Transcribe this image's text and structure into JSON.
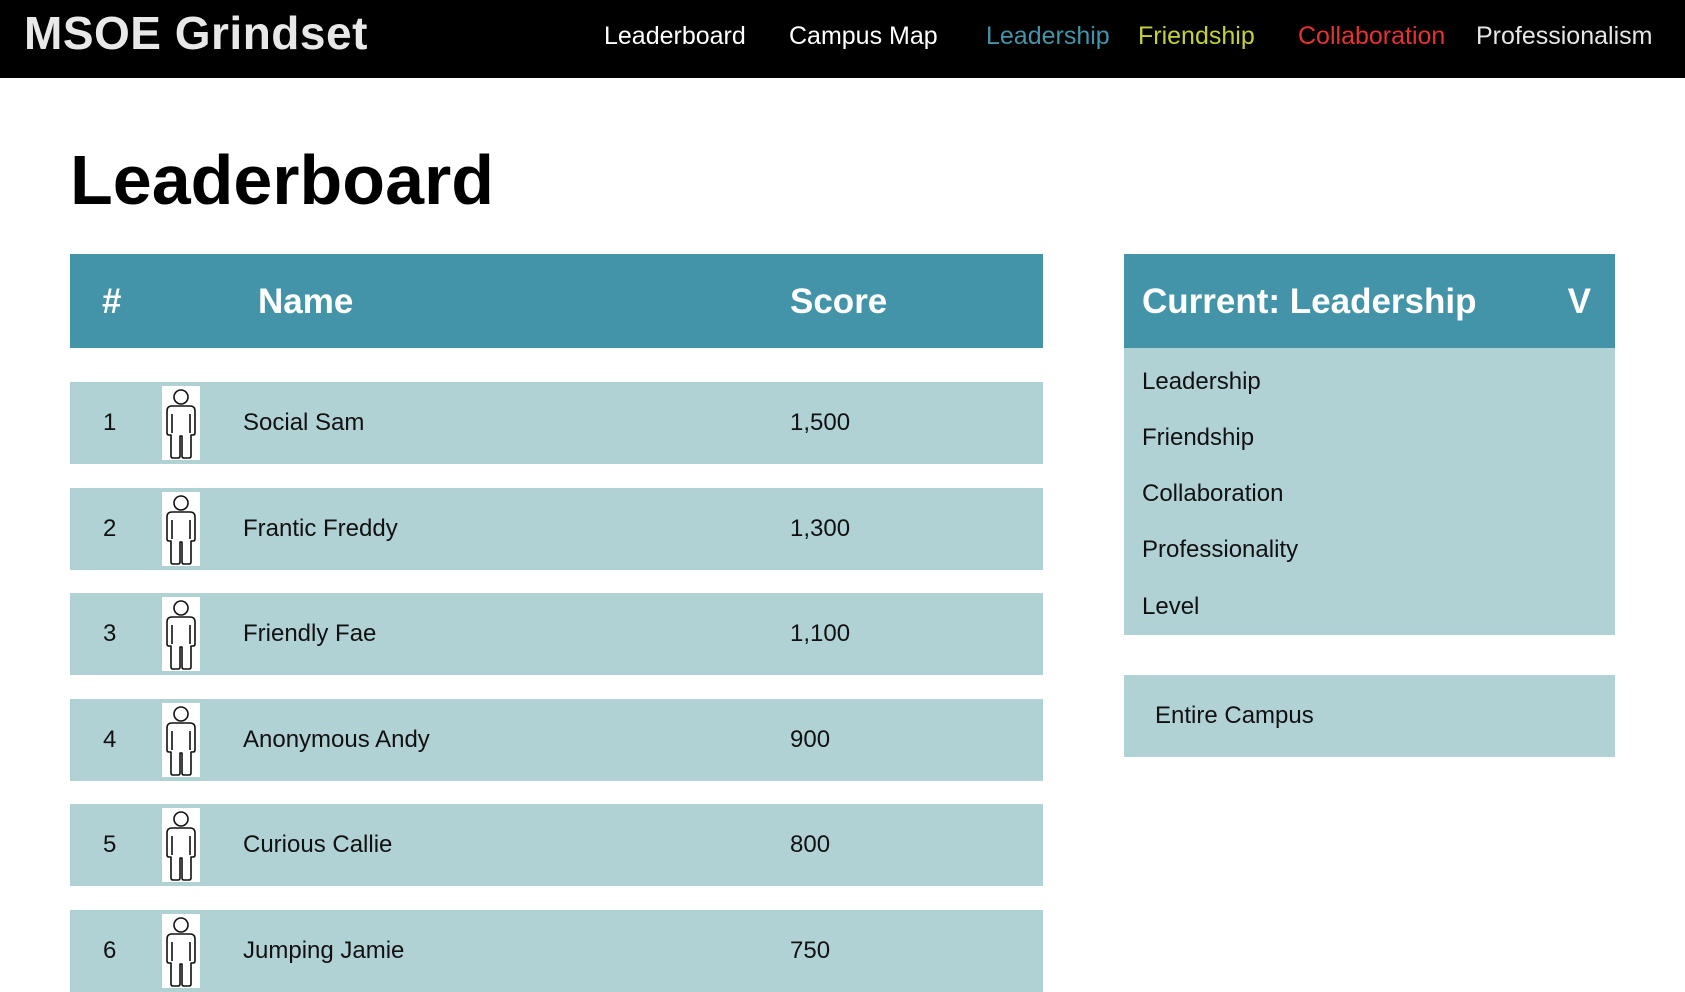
{
  "app": {
    "brand": "MSOE Grindset"
  },
  "nav": {
    "leaderboard": "Leaderboard",
    "campus_map": "Campus Map",
    "leadership": "Leadership",
    "friendship": "Friendship",
    "collaboration": "Collaboration",
    "professionalism": "Professionalism"
  },
  "colors": {
    "leadership": "#4394a8",
    "friendship": "#c6d13a",
    "collaboration": "#e53232",
    "professionalism": "#e6e6e6",
    "header_bg": "#4394a8",
    "row_bg": "#b1d2d5"
  },
  "page": {
    "title": "Leaderboard"
  },
  "table": {
    "headers": {
      "rank": "#",
      "name": "Name",
      "score": "Score"
    },
    "rows": [
      {
        "rank": "1",
        "name": "Social Sam",
        "score": "1,500",
        "avatar_icon": "person-outline-icon"
      },
      {
        "rank": "2",
        "name": "Frantic Freddy",
        "score": "1,300",
        "avatar_icon": "person-outline-icon"
      },
      {
        "rank": "3",
        "name": "Friendly Fae",
        "score": "1,100",
        "avatar_icon": "person-outline-icon"
      },
      {
        "rank": "4",
        "name": "Anonymous Andy",
        "score": "900",
        "avatar_icon": "person-outline-icon"
      },
      {
        "rank": "5",
        "name": "Curious Callie",
        "score": "800",
        "avatar_icon": "person-outline-icon"
      },
      {
        "rank": "6",
        "name": "Jumping Jamie",
        "score": "750",
        "avatar_icon": "person-outline-icon"
      }
    ]
  },
  "category_dropdown": {
    "current_label": "Current: Leadership",
    "caret": "V",
    "options": [
      "Leadership",
      "Friendship",
      "Collaboration",
      "Professionality",
      "Level"
    ]
  },
  "scope": {
    "label": "Entire Campus"
  }
}
